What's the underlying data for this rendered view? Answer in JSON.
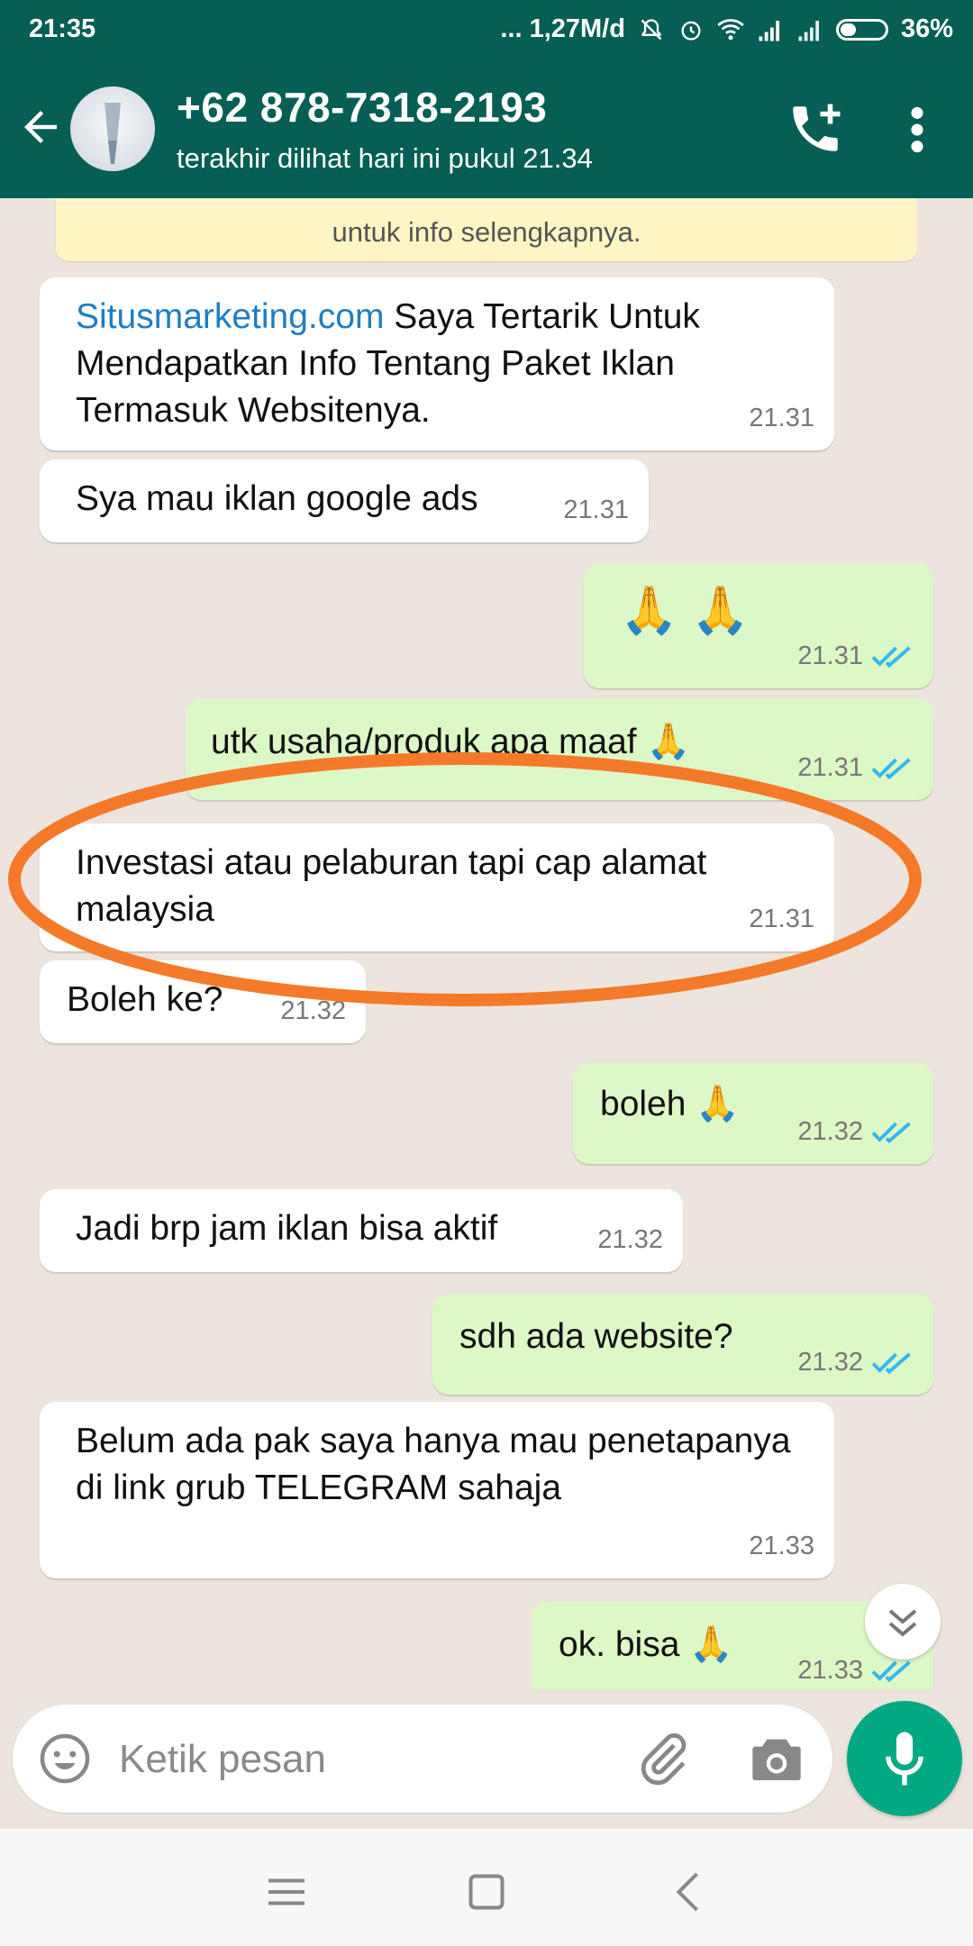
{
  "status_bar": {
    "time": "21:35",
    "network_speed": "... 1,27M/d",
    "battery": "36%",
    "battery_level": 0.36
  },
  "header": {
    "contact_name": "+62 878-7318-2193",
    "last_seen": "terakhir dilihat hari ini pukul 21.34",
    "icons": [
      "back-arrow-icon",
      "avatar",
      "add-call-icon",
      "more-vert-icon"
    ]
  },
  "system_note": "untuk info selengkapnya.",
  "messages": [
    {
      "dir": "in",
      "link": "Situsmarketing.com",
      "text": " Saya Tertarik Untuk Mendapatkan Info Tentang Paket Iklan Termasuk Websitenya.",
      "time": "21.31"
    },
    {
      "dir": "in",
      "text": "Sya mau iklan google ads",
      "time": "21.31"
    },
    {
      "dir": "out",
      "text": "🙏 🙏",
      "time": "21.31",
      "read": true
    },
    {
      "dir": "out",
      "text": "utk usaha/produk apa maaf 🙏",
      "time": "21.31",
      "read": true
    },
    {
      "dir": "in",
      "text": "Investasi atau pelaburan tapi cap alamat malaysia",
      "time": "21.31"
    },
    {
      "dir": "in",
      "text": "Boleh ke?",
      "time": "21.32"
    },
    {
      "dir": "out",
      "text": "boleh 🙏",
      "time": "21.32",
      "read": true
    },
    {
      "dir": "in",
      "text": "Jadi brp jam iklan bisa aktif",
      "time": "21.32"
    },
    {
      "dir": "out",
      "text": "sdh ada website?",
      "time": "21.32",
      "read": true
    },
    {
      "dir": "in",
      "text": "Belum ada pak saya hanya mau penetapanya di link grub TELEGRAM sahaja",
      "time": "21.33"
    },
    {
      "dir": "out",
      "text": "ok. bisa 🙏",
      "time": "21.33",
      "read": true
    }
  ],
  "input": {
    "placeholder": "Ketik pesan"
  },
  "colors": {
    "header": "#075E54",
    "chat_background": "#ECE5DD",
    "outgoing_bubble": "#DCF8C6",
    "incoming_bubble": "#FFFFFF",
    "read_ticks": "#34B7F1",
    "mic_button": "#00A884",
    "annotation_circle": "#F47A2A"
  }
}
